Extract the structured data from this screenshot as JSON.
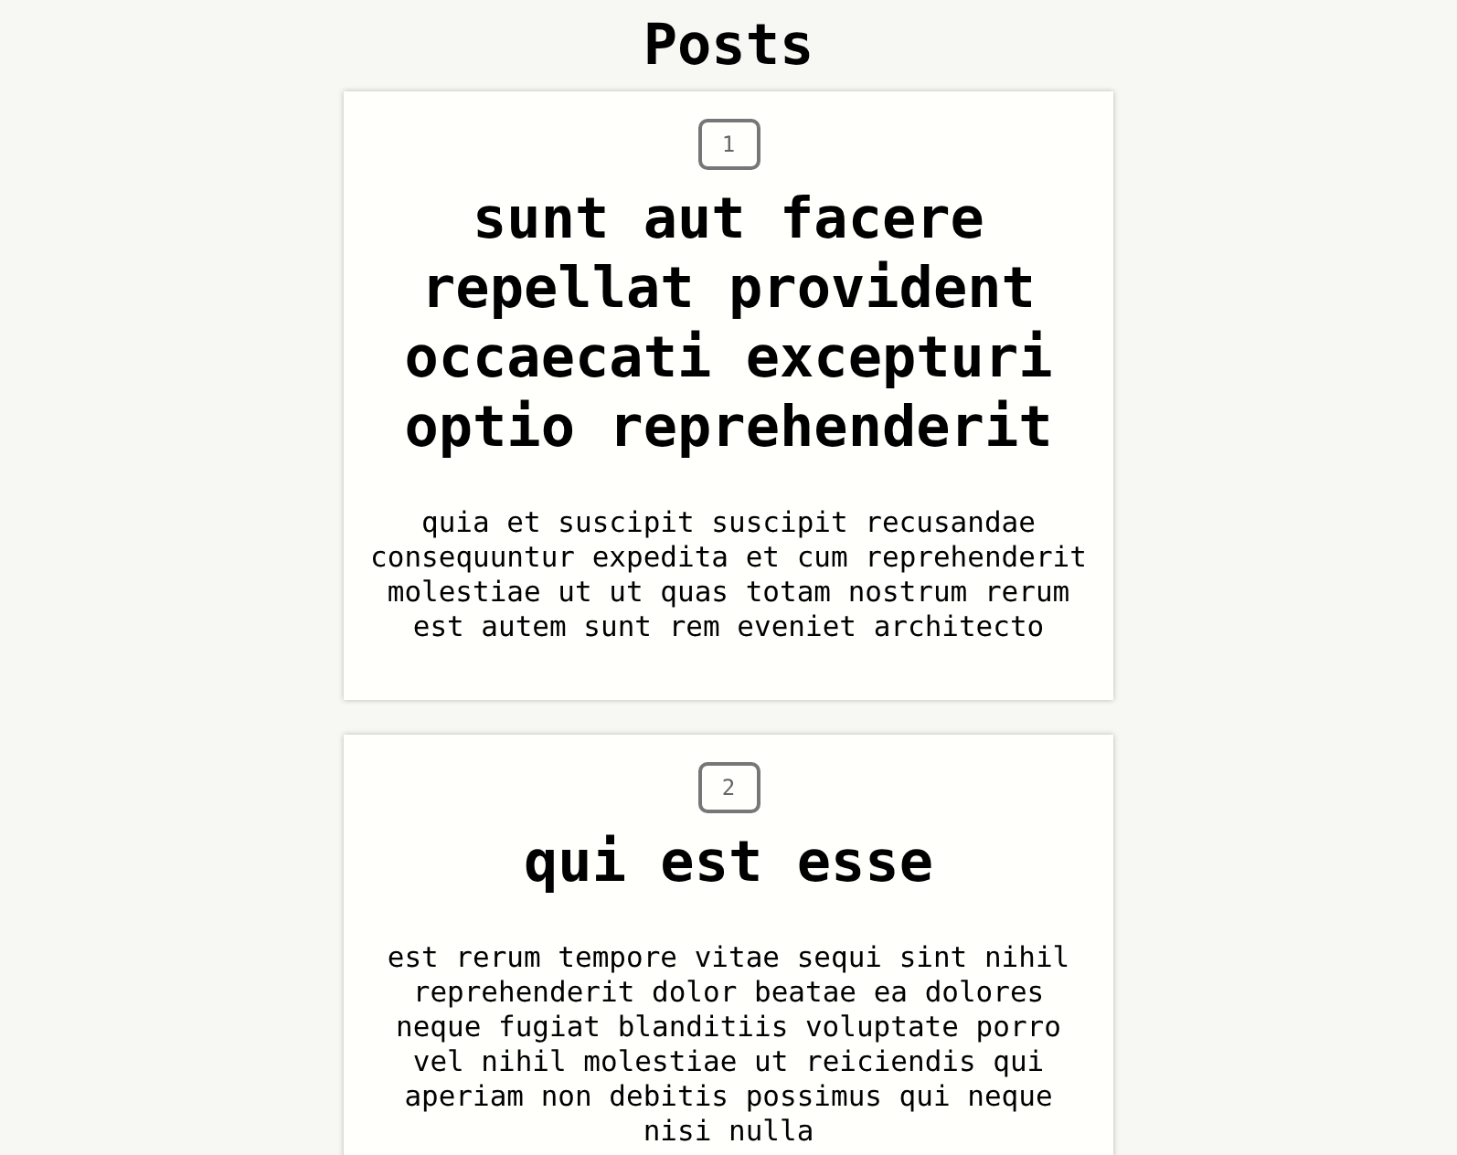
{
  "heading": "Posts",
  "posts": [
    {
      "number": "1",
      "title": "sunt aut facere repellat provident occaecati excepturi optio reprehenderit",
      "body": "quia et suscipit suscipit recusandae consequuntur expedita et cum reprehenderit molestiae ut ut quas totam nostrum rerum est autem sunt rem eveniet architecto"
    },
    {
      "number": "2",
      "title": "qui est esse",
      "body": "est rerum tempore vitae sequi sint nihil reprehenderit dolor beatae ea dolores neque fugiat blanditiis voluptate porro vel nihil molestiae ut reiciendis qui aperiam non debitis possimus qui neque nisi nulla"
    }
  ]
}
